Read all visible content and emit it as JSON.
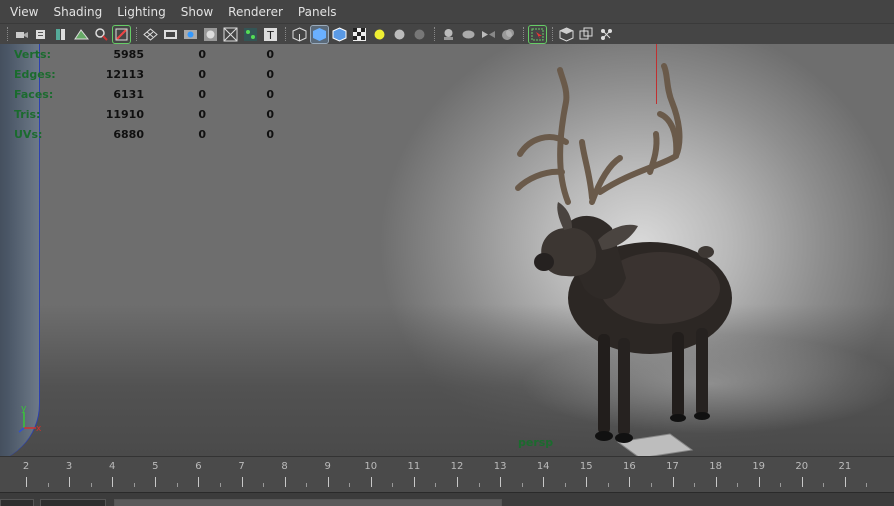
{
  "menu": [
    "View",
    "Shading",
    "Lighting",
    "Show",
    "Renderer",
    "Panels"
  ],
  "toolbar": {
    "icons": [
      "select-camera-icon",
      "camera-attributes-icon",
      "bookmarks-icon",
      "image-plane-icon",
      "two-d-pan-zoom-icon",
      "grease-pencil-icon",
      "grid-icon",
      "film-gate-icon",
      "resolution-gate-icon",
      "gate-mask-icon",
      "field-chart-icon",
      "safe-action-icon",
      "safe-title-icon",
      "wireframe-icon",
      "smooth-shade-icon",
      "wireframe-on-shaded-icon",
      "textured-icon",
      "use-all-lights-icon",
      "shadows-icon",
      "screen-space-ao-icon",
      "motion-blur-icon",
      "multisample-aa-icon",
      "depth-of-field-icon",
      "xray-icon",
      "xray-joints-icon",
      "xray-components-icon",
      "isolate-select-icon",
      "backface-culling-icon",
      "two-sided-lighting-icon",
      "toggle-hud-icon"
    ]
  },
  "hud": {
    "rows": [
      {
        "label": "Verts:",
        "v1": "5985",
        "v2": "0",
        "v3": "0"
      },
      {
        "label": "Edges:",
        "v1": "12113",
        "v2": "0",
        "v3": "0"
      },
      {
        "label": "Faces:",
        "v1": "6131",
        "v2": "0",
        "v3": "0"
      },
      {
        "label": "Tris:",
        "v1": "11910",
        "v2": "0",
        "v3": "0"
      },
      {
        "label": "UVs:",
        "v1": "6880",
        "v2": "0",
        "v3": "0"
      }
    ]
  },
  "viewport": {
    "camera": "persp",
    "axis": {
      "y": "y",
      "x": "x"
    }
  },
  "timeline": {
    "frames": [
      "2",
      "3",
      "4",
      "5",
      "6",
      "7",
      "8",
      "9",
      "10",
      "11",
      "12",
      "13",
      "14",
      "15",
      "16",
      "17",
      "18",
      "19",
      "20",
      "21"
    ]
  },
  "colors": {
    "hud_label": "#1b6b2e",
    "accent_axis_y": "#39c539",
    "accent_axis_x": "#d03030"
  }
}
